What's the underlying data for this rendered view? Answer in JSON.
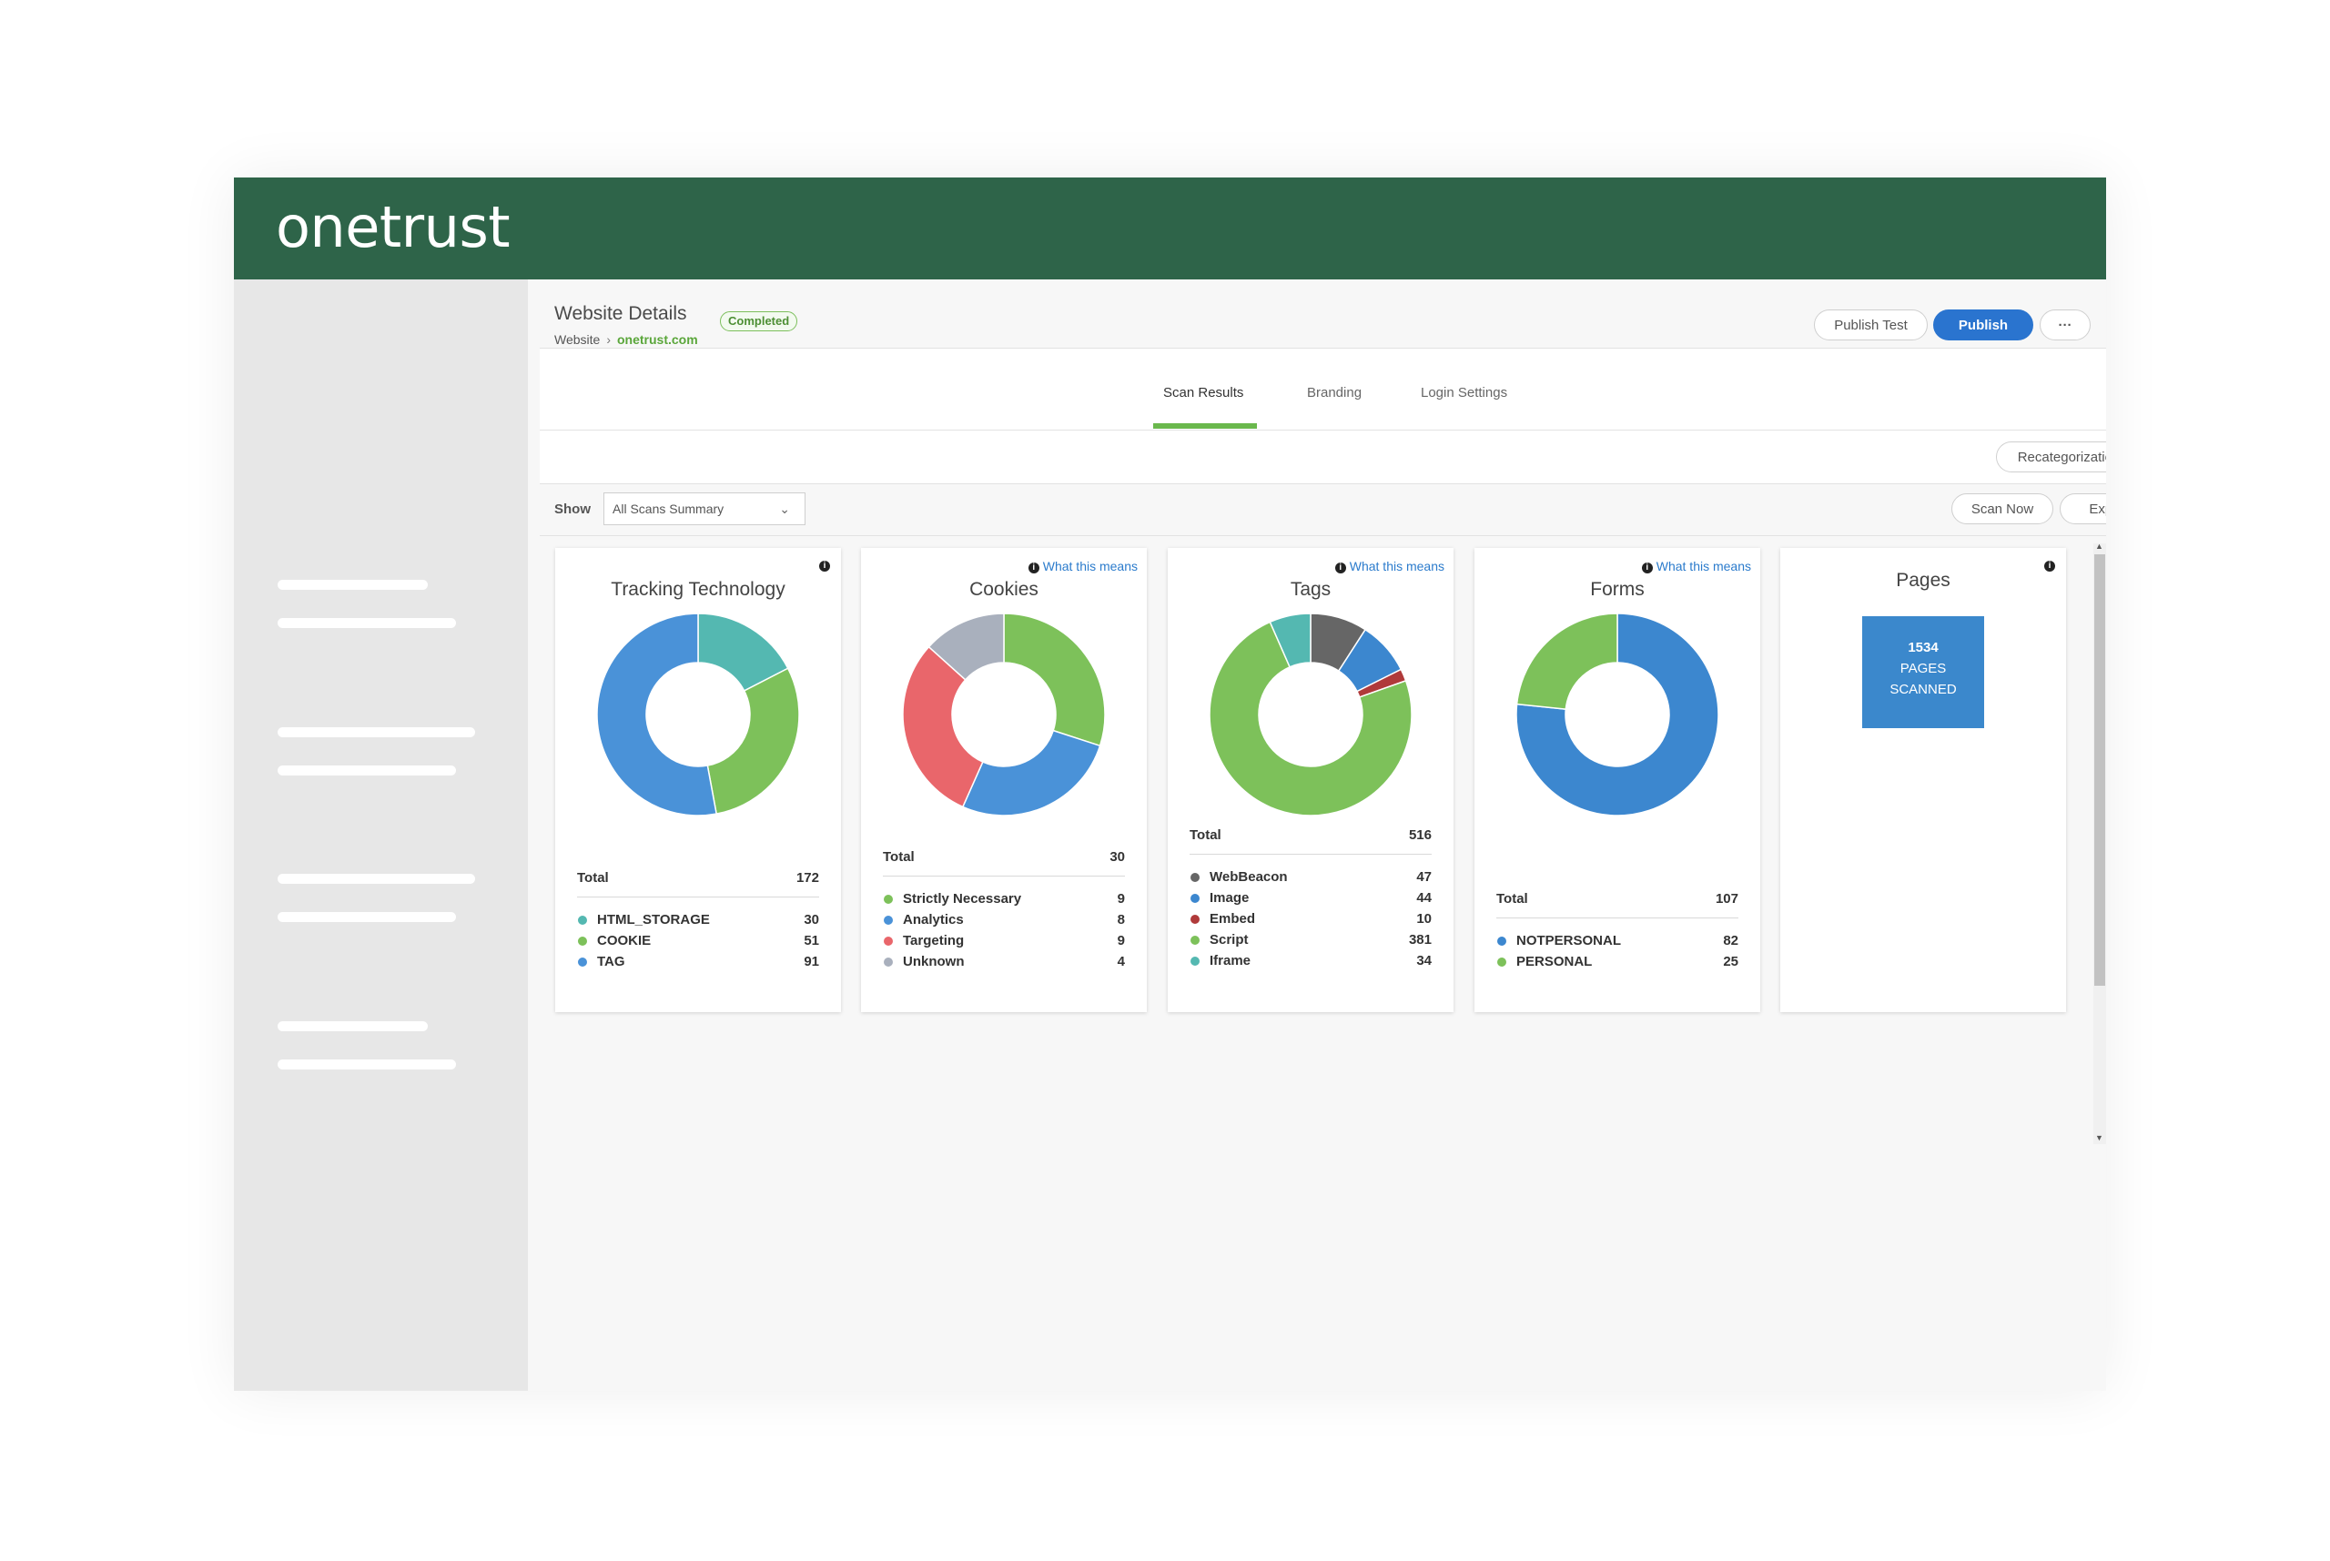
{
  "brand": {
    "logo_text": "onetrust",
    "header_color": "#2e6449"
  },
  "header": {
    "title": "Website Details",
    "status": "Completed",
    "breadcrumb": {
      "root": "Website",
      "separator": "›",
      "current": "onetrust.com"
    },
    "buttons": {
      "publish_test": "Publish Test",
      "publish": "Publish",
      "more": "···"
    }
  },
  "tabs": [
    {
      "label": "Scan Results",
      "active": true
    },
    {
      "label": "Branding",
      "active": false
    },
    {
      "label": "Login Settings",
      "active": false
    }
  ],
  "toolbar": {
    "recategorization": "Recategorization",
    "show_label": "Show",
    "show_value": "All Scans Summary",
    "scan_now": "Scan Now",
    "export": "Export"
  },
  "cards": {
    "tracking": {
      "title": "Tracking Technology",
      "total_label": "Total",
      "total": "172",
      "items": [
        {
          "label": "HTML_STORAGE",
          "value": "30",
          "color": "#54b8b1"
        },
        {
          "label": "COOKIE",
          "value": "51",
          "color": "#7dc15a"
        },
        {
          "label": "TAG",
          "value": "91",
          "color": "#4a92d8"
        }
      ]
    },
    "cookies": {
      "title": "Cookies",
      "info_link": "What this means",
      "total_label": "Total",
      "total": "30",
      "items": [
        {
          "label": "Strictly Necessary",
          "value": "9",
          "color": "#7dc15a"
        },
        {
          "label": "Analytics",
          "value": "8",
          "color": "#4a92d8"
        },
        {
          "label": "Targeting",
          "value": "9",
          "color": "#e9666b"
        },
        {
          "label": "Unknown",
          "value": "4",
          "color": "#a9b0bd"
        }
      ]
    },
    "tags": {
      "title": "Tags",
      "info_link": "What this means",
      "total_label": "Total",
      "total": "516",
      "items": [
        {
          "label": "WebBeacon",
          "value": "47",
          "color": "#666666"
        },
        {
          "label": "Image",
          "value": "44",
          "color": "#3c87cf"
        },
        {
          "label": "Embed",
          "value": "10",
          "color": "#b03a3a"
        },
        {
          "label": "Script",
          "value": "381",
          "color": "#7dc15a"
        },
        {
          "label": "Iframe",
          "value": "34",
          "color": "#54b8b1"
        }
      ]
    },
    "forms": {
      "title": "Forms",
      "info_link": "What this means",
      "total_label": "Total",
      "total": "107",
      "items": [
        {
          "label": "NOTPERSONAL",
          "value": "82",
          "color": "#3c87cf"
        },
        {
          "label": "PERSONAL",
          "value": "25",
          "color": "#7dc15a"
        }
      ]
    },
    "pages": {
      "title": "Pages",
      "count": "1534",
      "line1": "PAGES",
      "line2": "SCANNED"
    }
  }
}
